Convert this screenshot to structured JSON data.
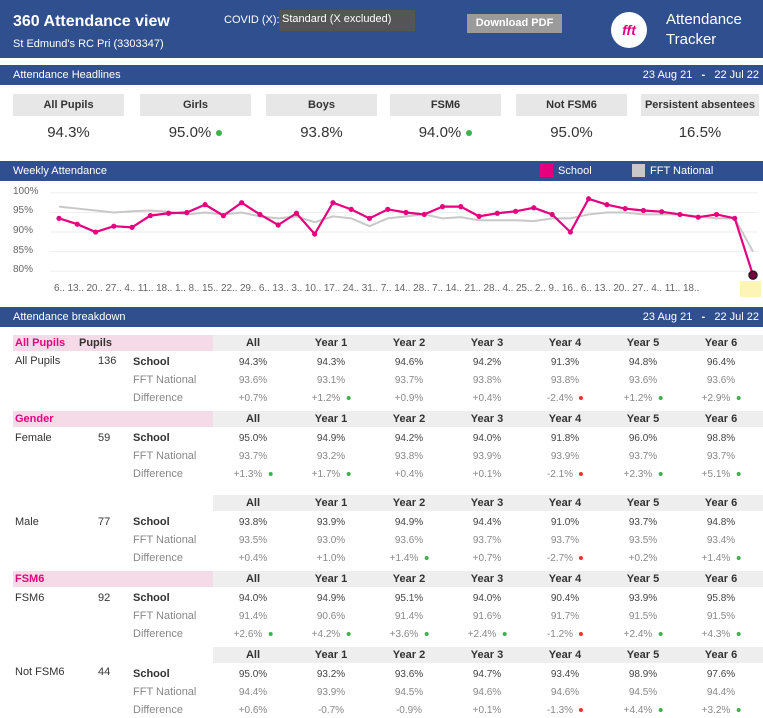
{
  "header": {
    "title": "360 Attendance view",
    "school": "St Edmund's RC Pri (3303347)",
    "covid_label": "COVID (X):",
    "covid_value": "Standard (X excluded)",
    "download": "Download PDF",
    "logo": "fft",
    "logo_text_1": "Attendance",
    "logo_text_2": "Tracker"
  },
  "headlines": {
    "title": "Attendance Headlines",
    "date_from": "23 Aug 21",
    "date_sep": "-",
    "date_to": "22 Jul 22",
    "items": [
      {
        "label": "All Pupils",
        "value": "94.3%",
        "dot": ""
      },
      {
        "label": "Girls",
        "value": "95.0%",
        "dot": "g"
      },
      {
        "label": "Boys",
        "value": "93.8%",
        "dot": ""
      },
      {
        "label": "FSM6",
        "value": "94.0%",
        "dot": "g"
      },
      {
        "label": "Not FSM6",
        "value": "95.0%",
        "dot": ""
      },
      {
        "label": "Persistent absentees",
        "value": "16.5%",
        "dot": ""
      }
    ]
  },
  "chart_section": {
    "title": "Weekly Attendance",
    "legend_school": "School",
    "legend_national": "FFT National",
    "school_color": "#e6007e",
    "national_color": "#c8c8c8"
  },
  "chart_data": {
    "type": "line",
    "title": "Weekly Attendance",
    "ylim": [
      78,
      101
    ],
    "y_ticks": [
      "100%",
      "95%",
      "90%",
      "85%",
      "80%"
    ],
    "x_tick_labels": "6.. 13.. 20.. 27.. 4.. 11.. 18.. 1.. 8.. 15.. 22.. 29.. 6.. 13.. 3.. 10.. 17.. 24.. 31.. 7.. 14.. 28.. 7.. 14.. 21.. 28.. 4.. 25.. 2.. 9.. 16.. 6.. 13.. 20.. 27.. 4.. 11.. 18..",
    "series": [
      {
        "name": "School",
        "values": [
          93.5,
          92,
          90,
          91.5,
          91.2,
          94.2,
          94.8,
          95,
          97,
          94.2,
          97.5,
          94.5,
          91.8,
          94.8,
          89.5,
          97.5,
          95.8,
          93.5,
          95.8,
          95,
          94.5,
          96.5,
          96.5,
          94,
          94.8,
          95.3,
          96.2,
          94.5,
          90,
          98.5,
          97,
          96,
          95.5,
          95.2,
          94.5,
          93.8,
          94.5,
          93.5,
          79
        ]
      },
      {
        "name": "FFT National",
        "values": [
          96.5,
          96,
          95.5,
          95,
          95.3,
          95.5,
          95.2,
          94.5,
          95,
          94.5,
          95,
          94,
          93.5,
          94,
          92.5,
          94,
          93.5,
          91.5,
          93.5,
          94,
          94.5,
          93.5,
          93.8,
          93,
          93,
          93,
          92.8,
          93.5,
          93.5,
          94.5,
          95,
          95,
          94.5,
          94.5,
          94.5,
          94,
          93.5,
          93.5,
          85
        ]
      }
    ]
  },
  "breakdown": {
    "title": "Attendance breakdown",
    "date_from": "23 Aug 21",
    "date_sep": "-",
    "date_to": "22 Jul 22",
    "pupils_header": "Pupils",
    "cols": [
      "All",
      "Year 1",
      "Year 2",
      "Year 3",
      "Year 4",
      "Year 5",
      "Year 6"
    ],
    "row_labels": [
      "School",
      "FFT National",
      "Difference"
    ],
    "groups": [
      {
        "section": "All Pupils",
        "name": "All Pupils",
        "pupils": "136",
        "school": [
          "94.3%",
          "94.3%",
          "94.6%",
          "94.2%",
          "91.3%",
          "94.8%",
          "96.4%"
        ],
        "national": [
          "93.6%",
          "93.1%",
          "93.7%",
          "93.8%",
          "93.8%",
          "93.6%",
          "93.6%"
        ],
        "diff": [
          "+0.7%",
          "+1.2%",
          "+0.9%",
          "+0.4%",
          "-2.4%",
          "+1.2%",
          "+2.9%"
        ],
        "dots": [
          "",
          "g",
          "",
          "",
          "r",
          "g",
          "g"
        ]
      },
      {
        "section": "Gender",
        "name": "Female",
        "pupils": "59",
        "school": [
          "95.0%",
          "94.9%",
          "94.2%",
          "94.0%",
          "91.8%",
          "96.0%",
          "98.8%"
        ],
        "national": [
          "93.7%",
          "93.2%",
          "93.8%",
          "93.9%",
          "93.9%",
          "93.7%",
          "93.7%"
        ],
        "diff": [
          "+1.3%",
          "+1.7%",
          "+0.4%",
          "+0.1%",
          "-2.1%",
          "+2.3%",
          "+5.1%"
        ],
        "dots": [
          "g",
          "g",
          "",
          "",
          "r",
          "g",
          "g"
        ]
      },
      {
        "section": "",
        "name": "Male",
        "pupils": "77",
        "school": [
          "93.8%",
          "93.9%",
          "94.9%",
          "94.4%",
          "91.0%",
          "93.7%",
          "94.8%"
        ],
        "national": [
          "93.5%",
          "93.0%",
          "93.6%",
          "93.7%",
          "93.7%",
          "93.5%",
          "93.4%"
        ],
        "diff": [
          "+0.4%",
          "+1.0%",
          "+1.4%",
          "+0.7%",
          "-2.7%",
          "+0.2%",
          "+1.4%"
        ],
        "dots": [
          "",
          "",
          "g",
          "",
          "r",
          "",
          "g"
        ]
      },
      {
        "section": "FSM6",
        "name": "FSM6",
        "pupils": "92",
        "school": [
          "94.0%",
          "94.9%",
          "95.1%",
          "94.0%",
          "90.4%",
          "93.9%",
          "95.8%"
        ],
        "national": [
          "91.4%",
          "90.6%",
          "91.4%",
          "91.6%",
          "91.7%",
          "91.5%",
          "91.5%"
        ],
        "diff": [
          "+2.6%",
          "+4.2%",
          "+3.6%",
          "+2.4%",
          "-1.2%",
          "+2.4%",
          "+4.3%"
        ],
        "dots": [
          "g",
          "g",
          "g",
          "g",
          "r",
          "g",
          "g"
        ]
      },
      {
        "section": "",
        "name": "Not FSM6",
        "pupils": "44",
        "school": [
          "95.0%",
          "93.2%",
          "93.6%",
          "94.7%",
          "93.4%",
          "98.9%",
          "97.6%"
        ],
        "national": [
          "94.4%",
          "93.9%",
          "94.5%",
          "94.6%",
          "94.6%",
          "94.5%",
          "94.4%"
        ],
        "diff": [
          "+0.6%",
          "-0.7%",
          "-0.9%",
          "+0.1%",
          "-1.3%",
          "+4.4%",
          "+3.2%"
        ],
        "dots": [
          "",
          "",
          "",
          "",
          "r",
          "g",
          "g"
        ]
      }
    ]
  }
}
